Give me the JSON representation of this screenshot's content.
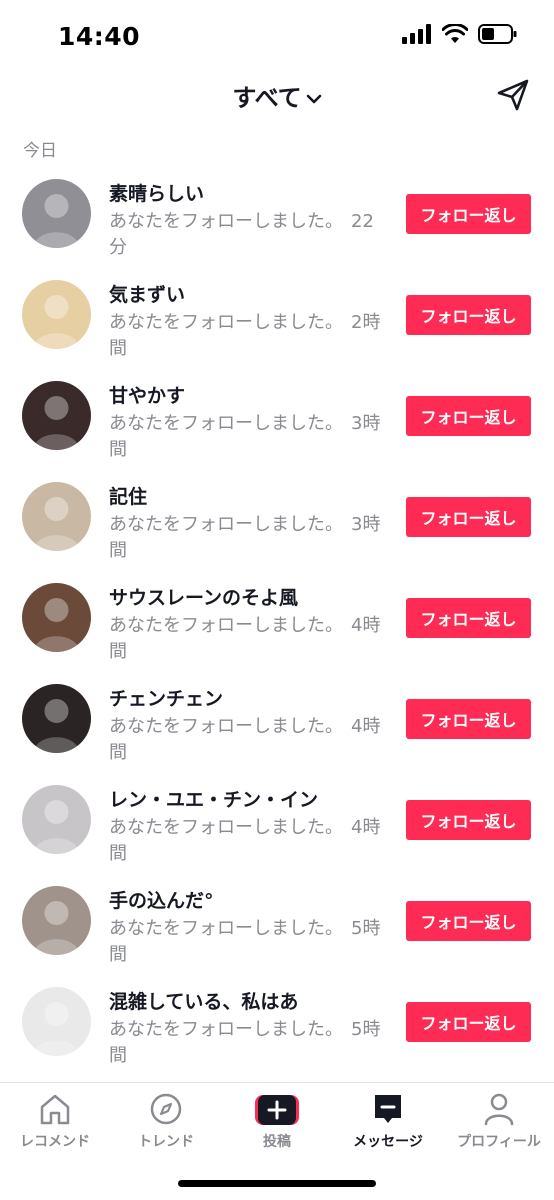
{
  "status_bar": {
    "time": "14:40",
    "battery_level": 0.45
  },
  "header": {
    "title": "すべて",
    "title_icon": "chevron-down-icon",
    "action_icon": "paper-plane-icon"
  },
  "section": {
    "label": "今日"
  },
  "notifications": [
    {
      "name": "素晴らしい",
      "message": "あなたをフォローしました。",
      "time": "22分",
      "button": "フォロー返し",
      "avatar_color": "#8f8f95"
    },
    {
      "name": "気まずい",
      "message": "あなたをフォローしました。",
      "time": "2時間",
      "button": "フォロー返し",
      "avatar_color": "#e7cfa4"
    },
    {
      "name": "甘やかす",
      "message": "あなたをフォローしました。",
      "time": "3時間",
      "button": "フォロー返し",
      "avatar_color": "#3a2a2a"
    },
    {
      "name": "記住",
      "message": "あなたをフォローしました。",
      "time": "3時間",
      "button": "フォロー返し",
      "avatar_color": "#c9b9a4"
    },
    {
      "name": "サウスレーンのそよ風",
      "message": "あなたをフォローしました。",
      "time": "4時間",
      "button": "フォロー返し",
      "avatar_color": "#6b4a3a"
    },
    {
      "name": "チェンチェン",
      "message": "あなたをフォローしました。",
      "time": "4時間",
      "button": "フォロー返し",
      "avatar_color": "#2a2424"
    },
    {
      "name": "レン・ユエ・チン・イン",
      "message": "あなたをフォローしました。",
      "time": "4時間",
      "button": "フォロー返し",
      "avatar_color": "#c8c5c8"
    },
    {
      "name": "手の込んだ°",
      "message": "あなたをフォローしました。",
      "time": "5時間",
      "button": "フォロー返し",
      "avatar_color": "#a0938c"
    },
    {
      "name": "混雑している、私はあ",
      "message": "あなたをフォローしました。",
      "time": "5時間",
      "button": "フォロー返し",
      "avatar_color": "#e9e9ea"
    }
  ],
  "bottom_nav": [
    {
      "label": "レコメンド",
      "icon": "home-icon",
      "active": false
    },
    {
      "label": "トレンド",
      "icon": "compass-icon",
      "active": false
    },
    {
      "label": "投稿",
      "icon": "plus-icon",
      "active": false
    },
    {
      "label": "メッセージ",
      "icon": "inbox-icon",
      "active": true
    },
    {
      "label": "プロフィール",
      "icon": "user-icon",
      "active": false
    }
  ],
  "colors": {
    "accent": "#fe2c55",
    "text": "#161823",
    "muted": "#8a8b91"
  }
}
